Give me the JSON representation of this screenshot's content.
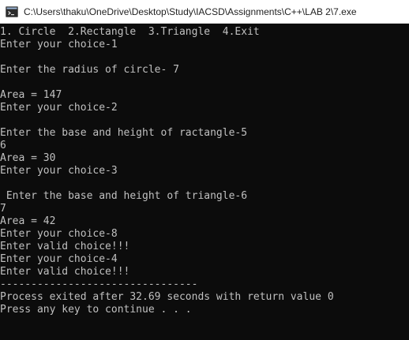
{
  "window": {
    "title": "C:\\Users\\thaku\\OneDrive\\Desktop\\Study\\IACSD\\Assignments\\C++\\LAB 2\\7.exe",
    "icon": "console-exe-icon"
  },
  "console": {
    "lines": [
      "1. Circle  2.Rectangle  3.Triangle  4.Exit",
      "Enter your choice-1",
      "",
      "Enter the radius of circle- 7",
      "",
      "Area = 147",
      "Enter your choice-2",
      "",
      "Enter the base and height of ractangle-5",
      "6",
      "Area = 30",
      "Enter your choice-3",
      "",
      " Enter the base and height of triangle-6",
      "7",
      "Area = 42",
      "Enter your choice-8",
      "Enter valid choice!!!",
      "Enter your choice-4",
      "Enter valid choice!!!",
      "--------------------------------",
      "Process exited after 32.69 seconds with return value 0",
      "Press any key to continue . . ."
    ]
  }
}
